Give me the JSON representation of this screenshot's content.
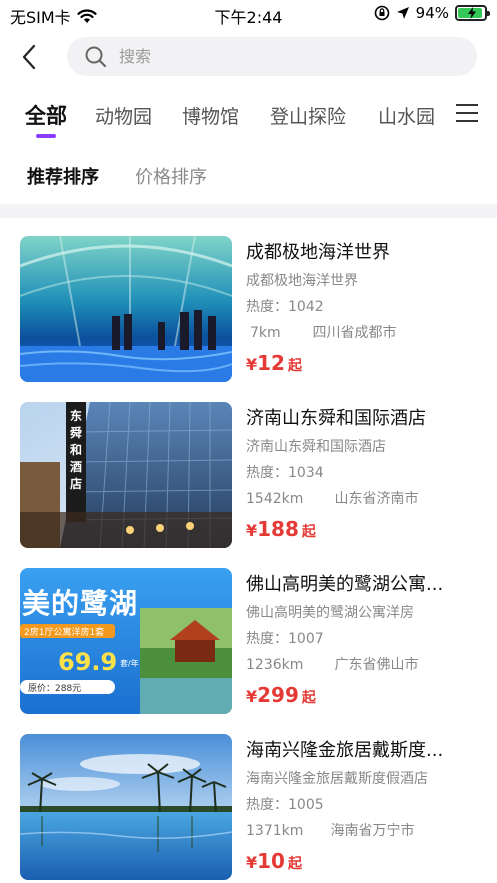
{
  "status_bar": {
    "carrier": "无SIM卡",
    "time": "下午2:44",
    "battery": "94%",
    "battery_level": 0.94
  },
  "search": {
    "placeholder": "搜索"
  },
  "tabs": [
    {
      "label": "全部",
      "active": true
    },
    {
      "label": "动物园",
      "active": false
    },
    {
      "label": "博物馆",
      "active": false
    },
    {
      "label": "登山探险",
      "active": false
    },
    {
      "label": "山水园",
      "active": false
    }
  ],
  "sort": {
    "recommend": "推荐排序",
    "price": "价格排序"
  },
  "items": [
    {
      "title": "成都极地海洋世界",
      "subtitle": "成都极地海洋世界",
      "heat": "热度：1042",
      "distance": "7km",
      "region": "四川省成都市",
      "price_symbol": "¥",
      "price": "12",
      "price_suffix": "起"
    },
    {
      "title": "济南山东舜和国际酒店",
      "subtitle": "济南山东舜和国际酒店",
      "heat": "热度：1034",
      "distance": "1542km",
      "region": "山东省济南市",
      "price_symbol": "¥",
      "price": "188",
      "price_suffix": "起",
      "sign_text": "东舜和酒店"
    },
    {
      "title": "佛山高明美的鹭湖公寓...",
      "subtitle": "佛山高明美的鹭湖公寓洋房",
      "heat": "热度：1007",
      "distance": "1236km",
      "region": "广东省佛山市",
      "price_symbol": "¥",
      "price": "299",
      "price_suffix": "起",
      "banner_title": "美的鹭湖",
      "banner_tag": "2房1厅公寓洋房1套",
      "banner_price": "69.9",
      "banner_unit": "套/年",
      "banner_original": "原价：288元"
    },
    {
      "title": "海南兴隆金旅居戴斯度...",
      "subtitle": "海南兴隆金旅居戴斯度假酒店",
      "heat": "热度：1005",
      "distance": "1371km",
      "region": "海南省万宁市",
      "price_symbol": "¥",
      "price": "10",
      "price_suffix": "起"
    }
  ],
  "colors": {
    "accent": "#8b3dff",
    "price": "#e53935",
    "battery": "#34c759"
  }
}
